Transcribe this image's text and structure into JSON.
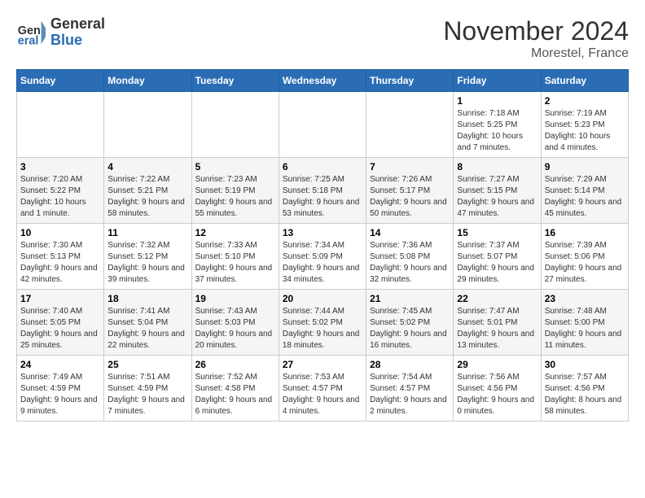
{
  "header": {
    "logo_line1": "General",
    "logo_line2": "Blue",
    "month": "November 2024",
    "location": "Morestel, France"
  },
  "weekdays": [
    "Sunday",
    "Monday",
    "Tuesday",
    "Wednesday",
    "Thursday",
    "Friday",
    "Saturday"
  ],
  "weeks": [
    [
      {
        "day": "",
        "info": ""
      },
      {
        "day": "",
        "info": ""
      },
      {
        "day": "",
        "info": ""
      },
      {
        "day": "",
        "info": ""
      },
      {
        "day": "",
        "info": ""
      },
      {
        "day": "1",
        "info": "Sunrise: 7:18 AM\nSunset: 5:25 PM\nDaylight: 10 hours and 7 minutes."
      },
      {
        "day": "2",
        "info": "Sunrise: 7:19 AM\nSunset: 5:23 PM\nDaylight: 10 hours and 4 minutes."
      }
    ],
    [
      {
        "day": "3",
        "info": "Sunrise: 7:20 AM\nSunset: 5:22 PM\nDaylight: 10 hours and 1 minute."
      },
      {
        "day": "4",
        "info": "Sunrise: 7:22 AM\nSunset: 5:21 PM\nDaylight: 9 hours and 58 minutes."
      },
      {
        "day": "5",
        "info": "Sunrise: 7:23 AM\nSunset: 5:19 PM\nDaylight: 9 hours and 55 minutes."
      },
      {
        "day": "6",
        "info": "Sunrise: 7:25 AM\nSunset: 5:18 PM\nDaylight: 9 hours and 53 minutes."
      },
      {
        "day": "7",
        "info": "Sunrise: 7:26 AM\nSunset: 5:17 PM\nDaylight: 9 hours and 50 minutes."
      },
      {
        "day": "8",
        "info": "Sunrise: 7:27 AM\nSunset: 5:15 PM\nDaylight: 9 hours and 47 minutes."
      },
      {
        "day": "9",
        "info": "Sunrise: 7:29 AM\nSunset: 5:14 PM\nDaylight: 9 hours and 45 minutes."
      }
    ],
    [
      {
        "day": "10",
        "info": "Sunrise: 7:30 AM\nSunset: 5:13 PM\nDaylight: 9 hours and 42 minutes."
      },
      {
        "day": "11",
        "info": "Sunrise: 7:32 AM\nSunset: 5:12 PM\nDaylight: 9 hours and 39 minutes."
      },
      {
        "day": "12",
        "info": "Sunrise: 7:33 AM\nSunset: 5:10 PM\nDaylight: 9 hours and 37 minutes."
      },
      {
        "day": "13",
        "info": "Sunrise: 7:34 AM\nSunset: 5:09 PM\nDaylight: 9 hours and 34 minutes."
      },
      {
        "day": "14",
        "info": "Sunrise: 7:36 AM\nSunset: 5:08 PM\nDaylight: 9 hours and 32 minutes."
      },
      {
        "day": "15",
        "info": "Sunrise: 7:37 AM\nSunset: 5:07 PM\nDaylight: 9 hours and 29 minutes."
      },
      {
        "day": "16",
        "info": "Sunrise: 7:39 AM\nSunset: 5:06 PM\nDaylight: 9 hours and 27 minutes."
      }
    ],
    [
      {
        "day": "17",
        "info": "Sunrise: 7:40 AM\nSunset: 5:05 PM\nDaylight: 9 hours and 25 minutes."
      },
      {
        "day": "18",
        "info": "Sunrise: 7:41 AM\nSunset: 5:04 PM\nDaylight: 9 hours and 22 minutes."
      },
      {
        "day": "19",
        "info": "Sunrise: 7:43 AM\nSunset: 5:03 PM\nDaylight: 9 hours and 20 minutes."
      },
      {
        "day": "20",
        "info": "Sunrise: 7:44 AM\nSunset: 5:02 PM\nDaylight: 9 hours and 18 minutes."
      },
      {
        "day": "21",
        "info": "Sunrise: 7:45 AM\nSunset: 5:02 PM\nDaylight: 9 hours and 16 minutes."
      },
      {
        "day": "22",
        "info": "Sunrise: 7:47 AM\nSunset: 5:01 PM\nDaylight: 9 hours and 13 minutes."
      },
      {
        "day": "23",
        "info": "Sunrise: 7:48 AM\nSunset: 5:00 PM\nDaylight: 9 hours and 11 minutes."
      }
    ],
    [
      {
        "day": "24",
        "info": "Sunrise: 7:49 AM\nSunset: 4:59 PM\nDaylight: 9 hours and 9 minutes."
      },
      {
        "day": "25",
        "info": "Sunrise: 7:51 AM\nSunset: 4:59 PM\nDaylight: 9 hours and 7 minutes."
      },
      {
        "day": "26",
        "info": "Sunrise: 7:52 AM\nSunset: 4:58 PM\nDaylight: 9 hours and 6 minutes."
      },
      {
        "day": "27",
        "info": "Sunrise: 7:53 AM\nSunset: 4:57 PM\nDaylight: 9 hours and 4 minutes."
      },
      {
        "day": "28",
        "info": "Sunrise: 7:54 AM\nSunset: 4:57 PM\nDaylight: 9 hours and 2 minutes."
      },
      {
        "day": "29",
        "info": "Sunrise: 7:56 AM\nSunset: 4:56 PM\nDaylight: 9 hours and 0 minutes."
      },
      {
        "day": "30",
        "info": "Sunrise: 7:57 AM\nSunset: 4:56 PM\nDaylight: 8 hours and 58 minutes."
      }
    ]
  ]
}
